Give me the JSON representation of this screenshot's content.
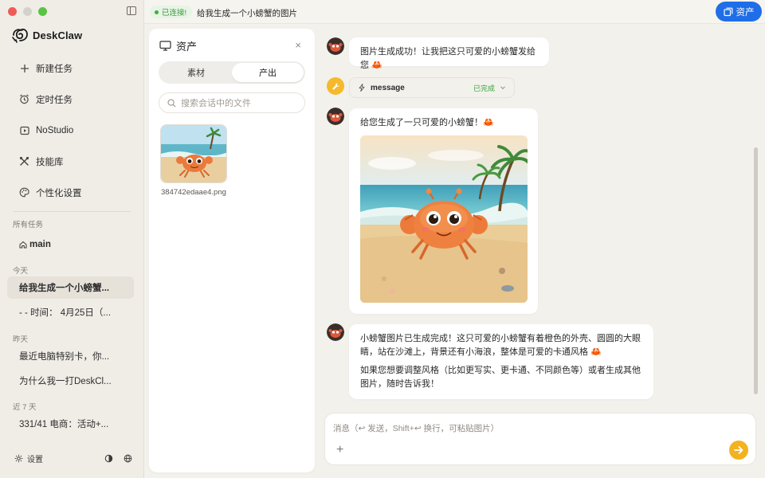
{
  "app": {
    "name": "DeskClaw"
  },
  "sidebar": {
    "nav": [
      {
        "label": "新建任务",
        "icon": "plus-icon"
      },
      {
        "label": "定时任务",
        "icon": "alarm-icon"
      },
      {
        "label": "NoStudio",
        "icon": "play-box-icon"
      },
      {
        "label": "技能库",
        "icon": "tools-icon"
      },
      {
        "label": "个性化设置",
        "icon": "palette-icon"
      }
    ],
    "all_tasks_label": "所有任务",
    "main_task": "main",
    "today_label": "今天",
    "today_tasks": [
      "给我生成一个小螃蟹...",
      "- - 时间： 4月25日（..."
    ],
    "yesterday_label": "昨天",
    "yesterday_tasks": [
      "最近电脑特别卡，你...",
      "为什么我一打DeskCl..."
    ],
    "last7_label": "近 7 天",
    "last7_tasks": [
      "331/41 电商：活动+..."
    ],
    "settings_label": "设置"
  },
  "topbar": {
    "status": "已连接!",
    "title": "给我生成一个小螃蟹的图片",
    "assets_button": "资产"
  },
  "assets_panel": {
    "title": "资产",
    "close": "×",
    "tabs": [
      "素材",
      "产出"
    ],
    "active_tab": "产出",
    "search_placeholder": "搜索会话中的文件",
    "files": [
      {
        "name": "384742edaae4.png"
      }
    ]
  },
  "chat": {
    "msg1": "图片生成成功！让我把这只可爱的小螃蟹发给您 🦀",
    "tool": {
      "name": "message",
      "status": "已完成"
    },
    "msg2": "给您生成了一只可爱的小螃蟹！🦀",
    "msg3_p1": "小螃蟹图片已生成完成！这只可爱的小螃蟹有着橙色的外壳、圆圆的大眼睛，站在沙滩上，背景还有小海浪，整体是可爱的卡通风格 🦀",
    "msg3_p2": "如果您想要调整风格（比如更写实、更卡通、不同颜色等）或者生成其他图片，随时告诉我！"
  },
  "composer": {
    "placeholder": "消息（↩ 发送，Shift+↩ 换行，可粘贴图片）"
  },
  "colors": {
    "accent_blue": "#1f6ee8",
    "send_yellow": "#f3b21f",
    "success_green": "#36a43a"
  }
}
